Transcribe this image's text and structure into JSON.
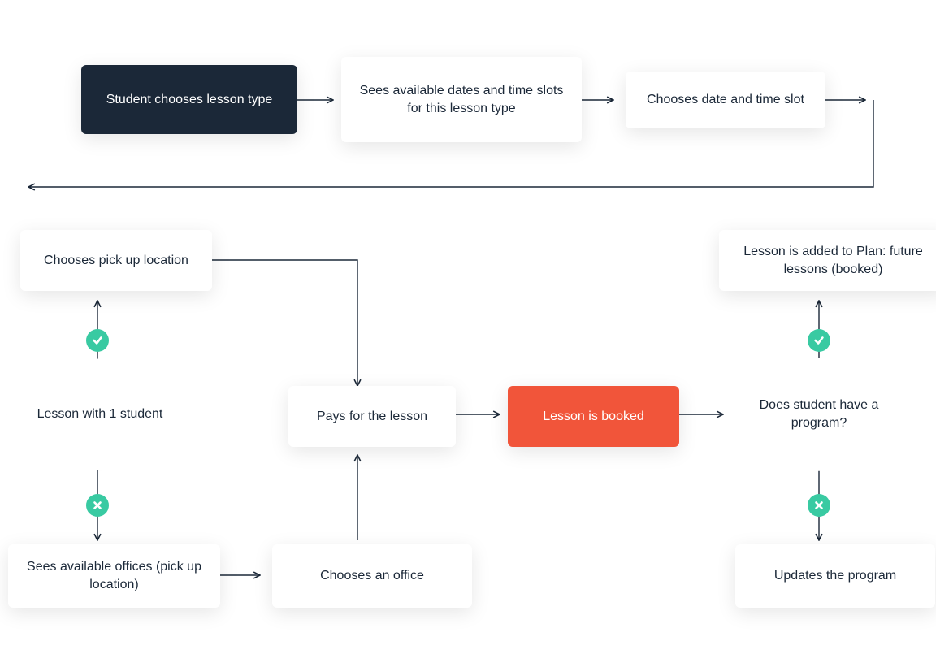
{
  "colors": {
    "dark": "#1b2838",
    "red": "#f1553a",
    "green": "#39caa2"
  },
  "n1": "Student chooses lesson type",
  "n2": "Sees available dates and time slots for this lesson type",
  "n3": "Chooses date and time slot",
  "n4": "Chooses pick up location",
  "n5": "Lesson is added to Plan: future lessons (booked)",
  "d1": "Lesson with 1 student",
  "n6": "Pays for the lesson",
  "n7": "Lesson is booked",
  "d2": "Does student have a program?",
  "n8": "Sees available offices (pick up location)",
  "n9": "Chooses an office",
  "n10": "Updates the program"
}
